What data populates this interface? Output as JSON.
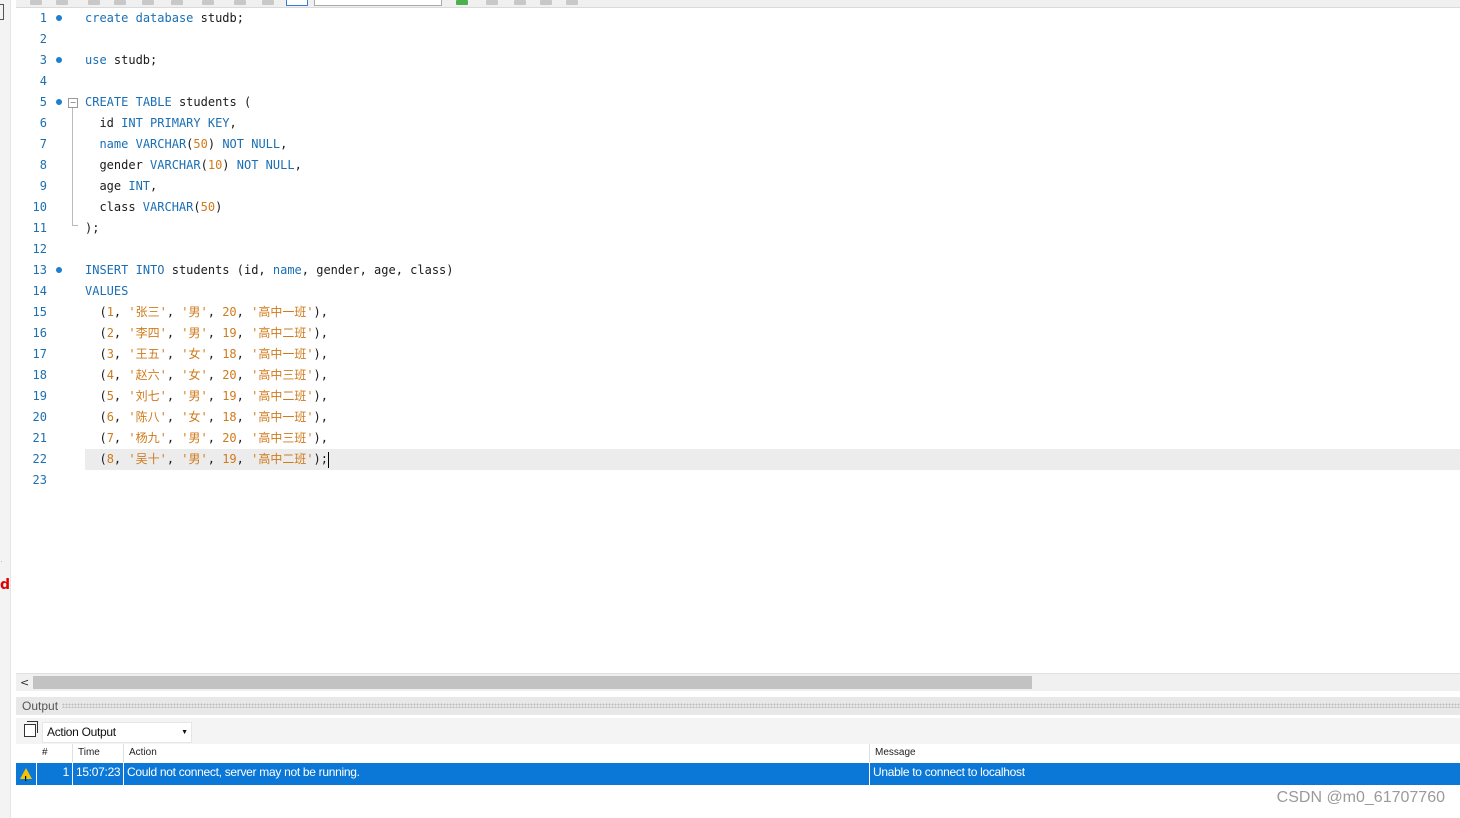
{
  "editor": {
    "lines": [
      {
        "n": "1",
        "tokens": [
          {
            "t": "create",
            "k": "kw"
          },
          {
            "t": " "
          },
          {
            "t": "database",
            "k": "kw"
          },
          {
            "t": " studb;"
          }
        ]
      },
      {
        "n": "2",
        "tokens": []
      },
      {
        "n": "3",
        "tokens": [
          {
            "t": "use",
            "k": "kw"
          },
          {
            "t": " studb;"
          }
        ]
      },
      {
        "n": "4",
        "tokens": []
      },
      {
        "n": "5",
        "tokens": [
          {
            "t": "CREATE",
            "k": "kw"
          },
          {
            "t": " "
          },
          {
            "t": "TABLE",
            "k": "kw"
          },
          {
            "t": " students ("
          }
        ]
      },
      {
        "n": "6",
        "tokens": [
          {
            "t": "  id "
          },
          {
            "t": "INT",
            "k": "kw"
          },
          {
            "t": " "
          },
          {
            "t": "PRIMARY",
            "k": "kw"
          },
          {
            "t": " "
          },
          {
            "t": "KEY",
            "k": "kw"
          },
          {
            "t": ","
          }
        ]
      },
      {
        "n": "7",
        "tokens": [
          {
            "t": "  "
          },
          {
            "t": "name",
            "k": "kw"
          },
          {
            "t": " "
          },
          {
            "t": "VARCHAR",
            "k": "kw"
          },
          {
            "t": "("
          },
          {
            "t": "50",
            "k": "num"
          },
          {
            "t": ") "
          },
          {
            "t": "NOT",
            "k": "kw"
          },
          {
            "t": " "
          },
          {
            "t": "NULL",
            "k": "kw"
          },
          {
            "t": ","
          }
        ]
      },
      {
        "n": "8",
        "tokens": [
          {
            "t": "  gender "
          },
          {
            "t": "VARCHAR",
            "k": "kw"
          },
          {
            "t": "("
          },
          {
            "t": "10",
            "k": "num"
          },
          {
            "t": ") "
          },
          {
            "t": "NOT",
            "k": "kw"
          },
          {
            "t": " "
          },
          {
            "t": "NULL",
            "k": "kw"
          },
          {
            "t": ","
          }
        ]
      },
      {
        "n": "9",
        "tokens": [
          {
            "t": "  age "
          },
          {
            "t": "INT",
            "k": "kw"
          },
          {
            "t": ","
          }
        ]
      },
      {
        "n": "10",
        "tokens": [
          {
            "t": "  class "
          },
          {
            "t": "VARCHAR",
            "k": "kw"
          },
          {
            "t": "("
          },
          {
            "t": "50",
            "k": "num"
          },
          {
            "t": ")"
          }
        ]
      },
      {
        "n": "11",
        "tokens": [
          {
            "t": ");"
          }
        ]
      },
      {
        "n": "12",
        "tokens": []
      },
      {
        "n": "13",
        "tokens": [
          {
            "t": "INSERT",
            "k": "kw"
          },
          {
            "t": " "
          },
          {
            "t": "INTO",
            "k": "kw"
          },
          {
            "t": " students (id, "
          },
          {
            "t": "name",
            "k": "kw"
          },
          {
            "t": ", gender, age, class)"
          }
        ]
      },
      {
        "n": "14",
        "tokens": [
          {
            "t": "VALUES",
            "k": "kw"
          }
        ]
      },
      {
        "n": "15",
        "tokens": [
          {
            "t": "  ("
          },
          {
            "t": "1",
            "k": "num"
          },
          {
            "t": ", "
          },
          {
            "t": "'张三'",
            "k": "str"
          },
          {
            "t": ", "
          },
          {
            "t": "'男'",
            "k": "str"
          },
          {
            "t": ", "
          },
          {
            "t": "20",
            "k": "num"
          },
          {
            "t": ", "
          },
          {
            "t": "'高中一班'",
            "k": "str"
          },
          {
            "t": "),"
          }
        ]
      },
      {
        "n": "16",
        "tokens": [
          {
            "t": "  ("
          },
          {
            "t": "2",
            "k": "num"
          },
          {
            "t": ", "
          },
          {
            "t": "'李四'",
            "k": "str"
          },
          {
            "t": ", "
          },
          {
            "t": "'男'",
            "k": "str"
          },
          {
            "t": ", "
          },
          {
            "t": "19",
            "k": "num"
          },
          {
            "t": ", "
          },
          {
            "t": "'高中二班'",
            "k": "str"
          },
          {
            "t": "),"
          }
        ]
      },
      {
        "n": "17",
        "tokens": [
          {
            "t": "  ("
          },
          {
            "t": "3",
            "k": "num"
          },
          {
            "t": ", "
          },
          {
            "t": "'王五'",
            "k": "str"
          },
          {
            "t": ", "
          },
          {
            "t": "'女'",
            "k": "str"
          },
          {
            "t": ", "
          },
          {
            "t": "18",
            "k": "num"
          },
          {
            "t": ", "
          },
          {
            "t": "'高中一班'",
            "k": "str"
          },
          {
            "t": "),"
          }
        ]
      },
      {
        "n": "18",
        "tokens": [
          {
            "t": "  ("
          },
          {
            "t": "4",
            "k": "num"
          },
          {
            "t": ", "
          },
          {
            "t": "'赵六'",
            "k": "str"
          },
          {
            "t": ", "
          },
          {
            "t": "'女'",
            "k": "str"
          },
          {
            "t": ", "
          },
          {
            "t": "20",
            "k": "num"
          },
          {
            "t": ", "
          },
          {
            "t": "'高中三班'",
            "k": "str"
          },
          {
            "t": "),"
          }
        ]
      },
      {
        "n": "19",
        "tokens": [
          {
            "t": "  ("
          },
          {
            "t": "5",
            "k": "num"
          },
          {
            "t": ", "
          },
          {
            "t": "'刘七'",
            "k": "str"
          },
          {
            "t": ", "
          },
          {
            "t": "'男'",
            "k": "str"
          },
          {
            "t": ", "
          },
          {
            "t": "19",
            "k": "num"
          },
          {
            "t": ", "
          },
          {
            "t": "'高中二班'",
            "k": "str"
          },
          {
            "t": "),"
          }
        ]
      },
      {
        "n": "20",
        "tokens": [
          {
            "t": "  ("
          },
          {
            "t": "6",
            "k": "num"
          },
          {
            "t": ", "
          },
          {
            "t": "'陈八'",
            "k": "str"
          },
          {
            "t": ", "
          },
          {
            "t": "'女'",
            "k": "str"
          },
          {
            "t": ", "
          },
          {
            "t": "18",
            "k": "num"
          },
          {
            "t": ", "
          },
          {
            "t": "'高中一班'",
            "k": "str"
          },
          {
            "t": "),"
          }
        ]
      },
      {
        "n": "21",
        "tokens": [
          {
            "t": "  ("
          },
          {
            "t": "7",
            "k": "num"
          },
          {
            "t": ", "
          },
          {
            "t": "'杨九'",
            "k": "str"
          },
          {
            "t": ", "
          },
          {
            "t": "'男'",
            "k": "str"
          },
          {
            "t": ", "
          },
          {
            "t": "20",
            "k": "num"
          },
          {
            "t": ", "
          },
          {
            "t": "'高中三班'",
            "k": "str"
          },
          {
            "t": "),"
          }
        ]
      },
      {
        "n": "22",
        "tokens": [
          {
            "t": "  ("
          },
          {
            "t": "8",
            "k": "num"
          },
          {
            "t": ", "
          },
          {
            "t": "'吴十'",
            "k": "str"
          },
          {
            "t": ", "
          },
          {
            "t": "'男'",
            "k": "str"
          },
          {
            "t": ", "
          },
          {
            "t": "19",
            "k": "num"
          },
          {
            "t": ", "
          },
          {
            "t": "'高中二班'",
            "k": "str"
          },
          {
            "t": ");"
          }
        ]
      },
      {
        "n": "23",
        "tokens": []
      }
    ],
    "statement_dot_lines": [
      "1",
      "3",
      "5",
      "13"
    ],
    "current_line": "22"
  },
  "side": {
    "letter": "d"
  },
  "output": {
    "title": "Output",
    "selector_value": "Action Output",
    "columns": {
      "num": "#",
      "time": "Time",
      "action": "Action",
      "message": "Message"
    },
    "rows": [
      {
        "status": "warning",
        "num": "1",
        "time": "15:07:23",
        "action": "Could not connect, server may not be running.",
        "message": "Unable to connect to localhost"
      }
    ]
  },
  "watermark": "CSDN @m0_61707760",
  "colors": {
    "keyword": "#1a6fb5",
    "literal": "#d07a1a",
    "selected_row": "#0b78d7",
    "warning": "#f5c400"
  }
}
